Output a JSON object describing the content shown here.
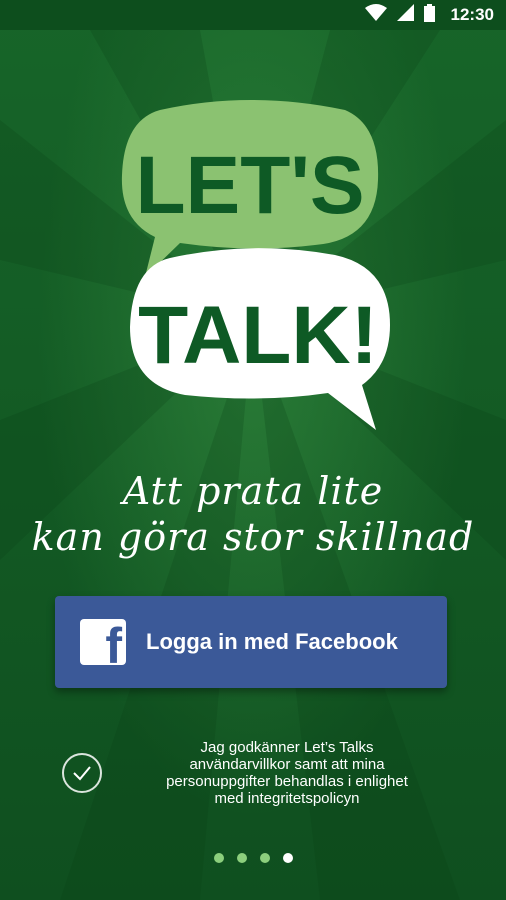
{
  "status_bar": {
    "time": "12:30",
    "icons": [
      "wifi-icon",
      "signal-icon",
      "battery-icon"
    ]
  },
  "logo": {
    "line1": "LET'S",
    "line2": "TALK!"
  },
  "tagline": {
    "line1": "Att prata lite",
    "line2": "kan göra stor skillnad"
  },
  "facebook_button": {
    "label": "Logga in med Facebook",
    "icon": "f"
  },
  "consent": {
    "line1": "Jag godkänner Let’s Talks",
    "line2": "användarvillkor samt att mina",
    "line3": "personuppgifter behandlas i enlighet",
    "line4": "med integritetspolicyn"
  },
  "pager": {
    "pages": 4,
    "active_index": 3
  },
  "colors": {
    "background": "#176529",
    "light_bubble": "#8bc271",
    "dark_text": "#0e5a25",
    "facebook_blue": "#3b5998"
  }
}
